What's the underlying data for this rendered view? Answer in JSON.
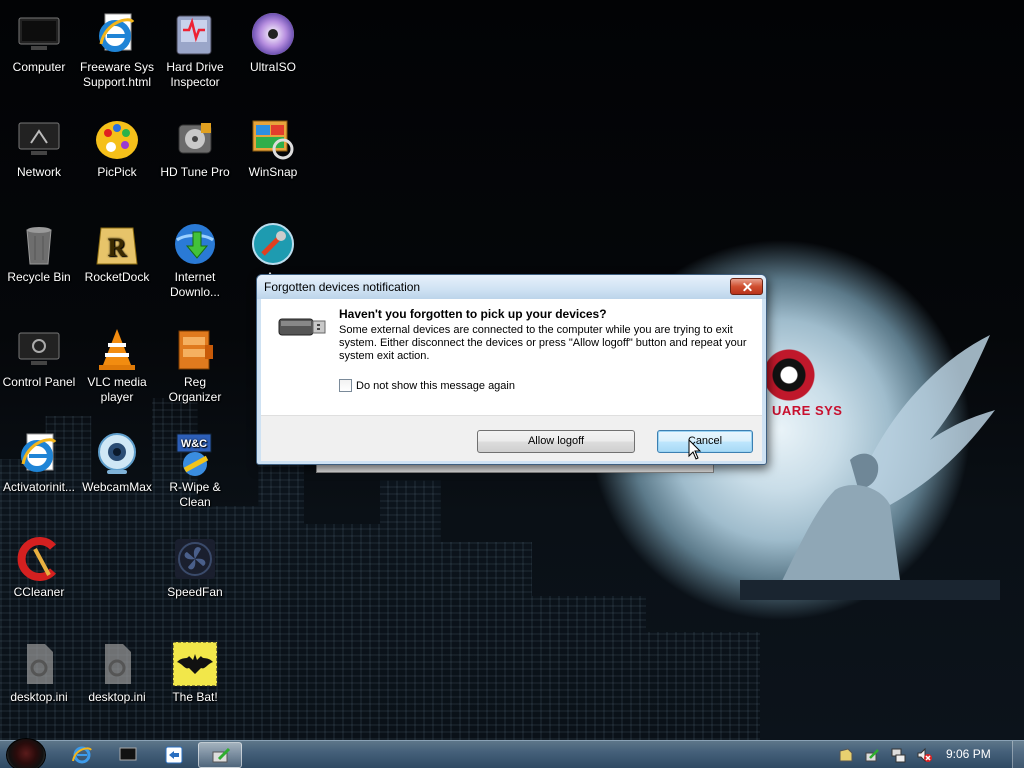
{
  "desktop": {
    "icons": [
      {
        "label": "Computer",
        "icon": "computer-icon"
      },
      {
        "label": "Freeware Sys Support.html",
        "icon": "internet-explorer-icon"
      },
      {
        "label": "Hard Drive Inspector",
        "icon": "hard-drive-inspector-icon"
      },
      {
        "label": "UltraISO",
        "icon": "disc-icon"
      },
      {
        "label": "Network",
        "icon": "network-icon"
      },
      {
        "label": "PicPick",
        "icon": "palette-icon"
      },
      {
        "label": "HD Tune Pro",
        "icon": "hard-disk-icon"
      },
      {
        "label": "WinSnap",
        "icon": "winsnap-icon"
      },
      {
        "label": "Recycle Bin",
        "icon": "recycle-bin-icon"
      },
      {
        "label": "RocketDock",
        "icon": "rocketdock-icon"
      },
      {
        "label": "Internet Downlo...",
        "icon": "download-manager-icon"
      },
      {
        "label": "As",
        "icon": "tools-icon"
      },
      {
        "label": "Control Panel",
        "icon": "control-panel-icon"
      },
      {
        "label": "VLC media player",
        "icon": "vlc-cone-icon"
      },
      {
        "label": "Reg Organizer",
        "icon": "reg-organizer-icon"
      },
      {
        "label": "Activatorinit...",
        "icon": "internet-explorer-icon"
      },
      {
        "label": "WebcamMax",
        "icon": "webcam-icon"
      },
      {
        "label": "R-Wipe & Clean",
        "icon": "rwipe-icon"
      },
      {
        "label": "CCleaner",
        "icon": "ccleaner-icon"
      },
      {
        "label": "SpeedFan",
        "icon": "fan-icon"
      },
      {
        "label": "desktop.ini",
        "icon": "settings-file-icon"
      },
      {
        "label": "desktop.ini",
        "icon": "settings-file-icon"
      },
      {
        "label": "The Bat!",
        "icon": "bat-icon"
      }
    ]
  },
  "wallpaper": {
    "brand_text": "UARE SYS"
  },
  "dialog": {
    "title": "Forgotten devices notification",
    "heading": "Haven't you forgotten to pick up your devices?",
    "body": "Some external devices are connected to the computer while you are trying to exit system. Either disconnect the devices or press \"Allow logoff\" button and repeat your system exit action.",
    "checkbox_label": "Do not show this message again",
    "checkbox_checked": false,
    "allow_button": "Allow logoff",
    "cancel_button": "Cancel"
  },
  "taskbar": {
    "clock": "9:06 PM",
    "pinned": [
      "internet-explorer-icon",
      "terminal-icon",
      "teamviewer-icon",
      "safely-remove-icon"
    ],
    "tray": [
      "action-center-icon",
      "safely-remove-icon",
      "network-icon",
      "volume-muted-icon"
    ]
  },
  "colors": {
    "dialog_frame": "#cfe2f3",
    "cancel_focus": "#3c7fb1",
    "taskbar": "#45607a",
    "brand_red": "#c8102e"
  }
}
